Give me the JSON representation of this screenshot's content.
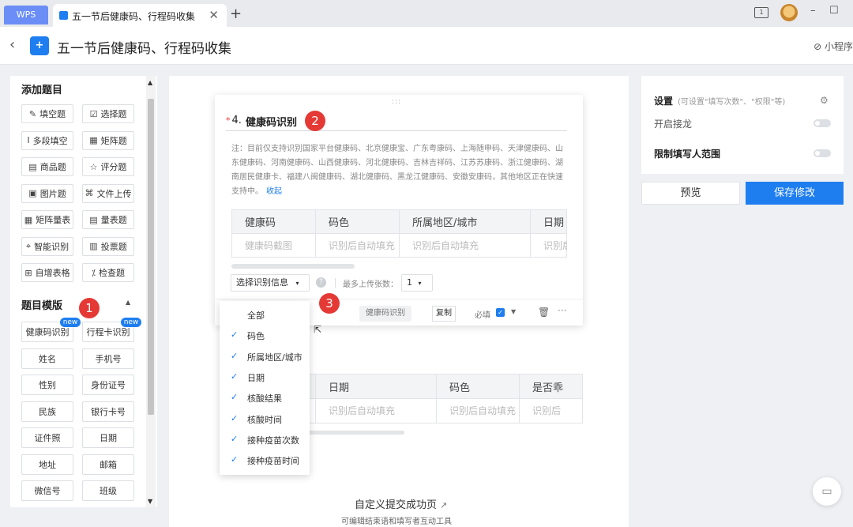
{
  "browser": {
    "wps_tab": "WPS",
    "doc_tab_title": "五一节后健康码、行程码收集",
    "close_glyph": "✕",
    "new_tab_glyph": "+",
    "minimize_glyph": "–",
    "maximize_glyph": "☐",
    "screen_badge": "1"
  },
  "header": {
    "title": "五一节后健康码、行程码收集",
    "mini_program": "小程序",
    "back_glyph": "‹"
  },
  "left": {
    "add_title": "添加题目",
    "types": [
      {
        "icon": "✎",
        "label": "填空题"
      },
      {
        "icon": "☑",
        "label": "选择题"
      },
      {
        "icon": "Ⅰ",
        "label": "多段填空"
      },
      {
        "icon": "▦",
        "label": "矩阵题"
      },
      {
        "icon": "▤",
        "label": "商品题"
      },
      {
        "icon": "☆",
        "label": "评分题"
      },
      {
        "icon": "▣",
        "label": "图片题"
      },
      {
        "icon": "⌘",
        "label": "文件上传"
      },
      {
        "icon": "▦",
        "label": "矩阵量表"
      },
      {
        "icon": "▤",
        "label": "量表题"
      },
      {
        "icon": "⌖",
        "label": "智能识别"
      },
      {
        "icon": "▥",
        "label": "投票题"
      },
      {
        "icon": "⊞",
        "label": "自增表格"
      },
      {
        "icon": "⁒",
        "label": "检查题"
      }
    ],
    "template_title": "题目模版",
    "templates": [
      "健康码识别",
      "行程卡识别",
      "姓名",
      "手机号",
      "性别",
      "身份证号",
      "民族",
      "银行卡号",
      "证件照",
      "日期",
      "地址",
      "邮箱",
      "微信号",
      "班级"
    ],
    "new_badge": "new"
  },
  "card": {
    "drag": ":::",
    "required_mark": "*",
    "number": "4.",
    "title": "健康码识别",
    "note": "注：目前仅支持识别国家平台健康码、北京健康宝、广东粤康码、上海随申码、天津健康码、山东健康码、河南健康码、山西健康码、河北健康码、吉林吉祥码、江苏苏康码、浙江健康码、湖南居民健康卡、福建八闽健康码、湖北健康码、黑龙江健康码、安徽安康码，其他地区正在快速支持中。",
    "fold": "收起",
    "columns": [
      "健康码",
      "码色",
      "所属地区/城市",
      "日期"
    ],
    "row": [
      "健康码截图",
      "识别后自动填充",
      "识别后自动填充",
      "识别后"
    ],
    "select_info": "选择识别信息",
    "help": "?",
    "max_upload_label": "最多上传张数：",
    "max_upload_value": "1",
    "tag": "健康码识别",
    "copy": "复制",
    "required_label": "必填",
    "check": "✓"
  },
  "table2": {
    "columns": [
      "",
      "日期",
      "码色",
      "是否乖"
    ],
    "row": [
      "",
      "识别后自动填充",
      "识别后自动填充",
      "识别后"
    ]
  },
  "dropdown": {
    "items": [
      {
        "label": "全部",
        "checked": false
      },
      {
        "label": "码色",
        "checked": true
      },
      {
        "label": "所属地区/城市",
        "checked": true
      },
      {
        "label": "日期",
        "checked": true
      },
      {
        "label": "核酸结果",
        "checked": true
      },
      {
        "label": "核酸时间",
        "checked": true
      },
      {
        "label": "接种疫苗次数",
        "checked": true
      },
      {
        "label": "接种疫苗时间",
        "checked": true
      }
    ]
  },
  "footer": {
    "custom_submit": "自定义提交成功页",
    "custom_sub": "可编辑结束语和填写者互动工具"
  },
  "right": {
    "settings": "设置",
    "settings_hint": "(可设置\"填写次数\"、\"权限\"等)",
    "relay": "开启接龙",
    "limit": "限制填写人范围",
    "preview": "预览",
    "save": "保存修改"
  },
  "markers": [
    "1",
    "2",
    "3"
  ],
  "colors": {
    "accent": "#1e7ef0",
    "marker": "#e53935",
    "wps_tab": "#6a8ef5"
  }
}
